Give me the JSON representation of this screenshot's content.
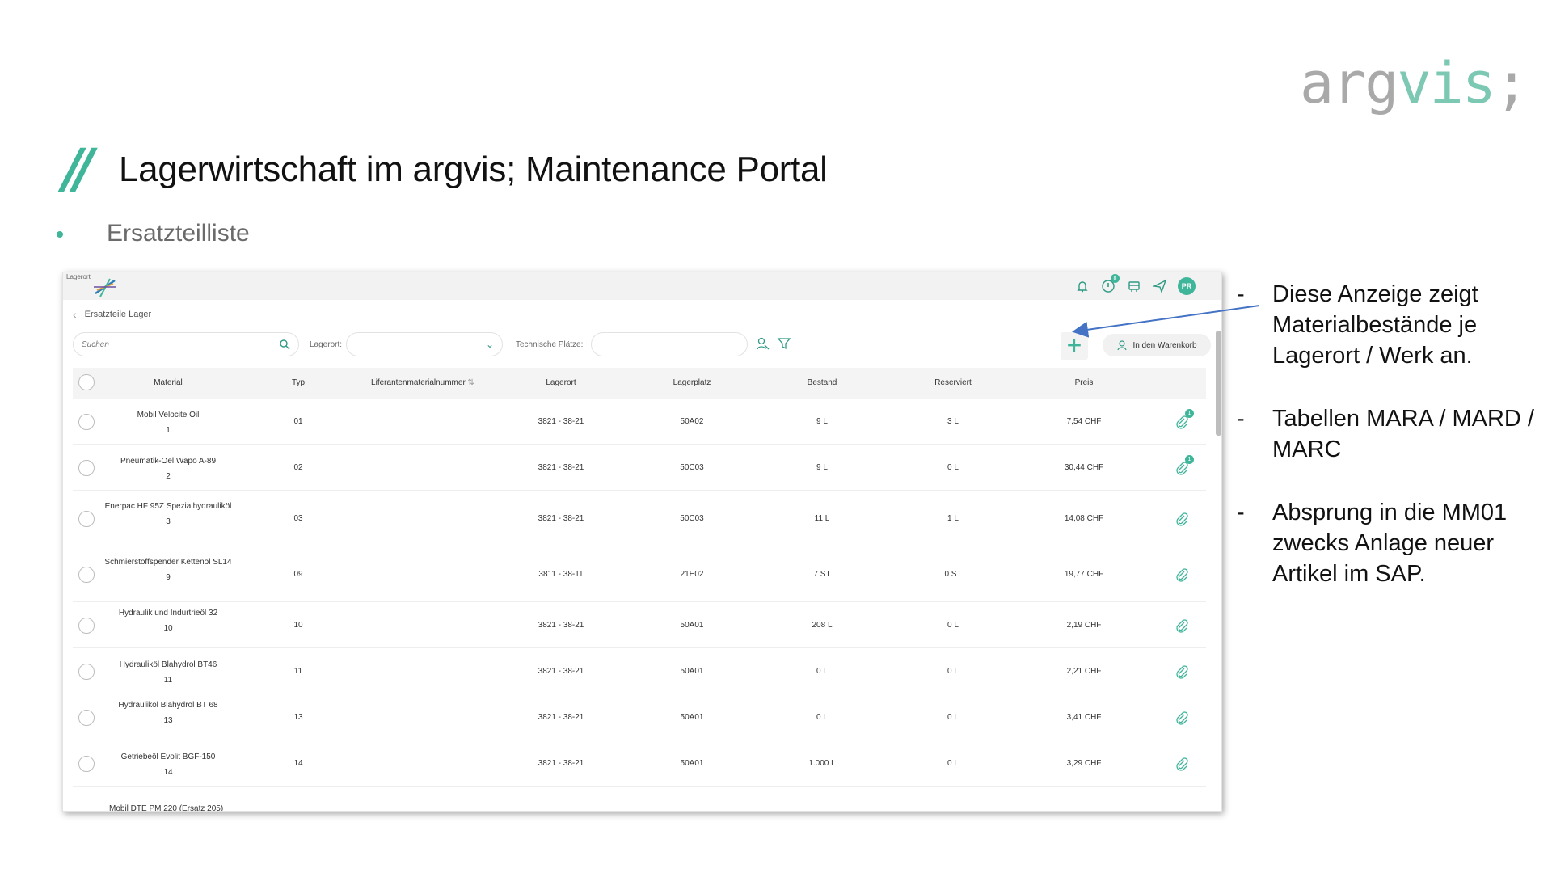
{
  "slide": {
    "logo_part1": "arg",
    "logo_part2": "vis",
    "logo_part3": ";",
    "slashes": "//",
    "title": "Lagerwirtschaft im argvis; Maintenance Portal",
    "subtitle": "Ersatzteilliste"
  },
  "app": {
    "topbar_tag": "Lagerort",
    "notification_badge": "8",
    "avatar_initials": "PR",
    "breadcrumb": "Ersatzteile Lager",
    "search_placeholder": "Suchen",
    "lagerort_label": "Lagerort:",
    "plaetze_label": "Technische Plätze:",
    "cart_label": "In den Warenkorb",
    "columns": {
      "material": "Material",
      "typ": "Typ",
      "lieferant": "Liferantenmaterialnummer",
      "sort": "⇅",
      "lagerort": "Lagerort",
      "lagerplatz": "Lagerplatz",
      "bestand": "Bestand",
      "reserviert": "Reserviert",
      "preis": "Preis"
    },
    "rows": [
      {
        "name": "Mobil Velocite Oil",
        "num": "1",
        "typ": "01",
        "lagerort": "3821 - 38-21",
        "lagerplatz": "50A02",
        "bestand": "9 L",
        "reserviert": "3 L",
        "preis": "7,54 CHF",
        "attachments": "1"
      },
      {
        "name": "Pneumatik-Oel Wapo A-89",
        "num": "2",
        "typ": "02",
        "lagerort": "3821 - 38-21",
        "lagerplatz": "50C03",
        "bestand": "9 L",
        "reserviert": "0 L",
        "preis": "30,44 CHF",
        "attachments": "1"
      },
      {
        "name": "Enerpac HF 95Z Spezialhydrauliköl",
        "num": "3",
        "typ": "03",
        "lagerort": "3821 - 38-21",
        "lagerplatz": "50C03",
        "bestand": "11 L",
        "reserviert": "1 L",
        "preis": "14,08 CHF",
        "attachments": ""
      },
      {
        "name": "Schmierstoffspender Kettenöl SL14",
        "num": "9",
        "typ": "09",
        "lagerort": "3811 - 38-11",
        "lagerplatz": "21E02",
        "bestand": "7 ST",
        "reserviert": "0 ST",
        "preis": "19,77 CHF",
        "attachments": ""
      },
      {
        "name": "Hydraulik und Indurtrieöl 32",
        "num": "10",
        "typ": "10",
        "lagerort": "3821 - 38-21",
        "lagerplatz": "50A01",
        "bestand": "208 L",
        "reserviert": "0 L",
        "preis": "2,19 CHF",
        "attachments": ""
      },
      {
        "name": "Hydrauliköl Blahydrol BT46",
        "num": "11",
        "typ": "11",
        "lagerort": "3821 - 38-21",
        "lagerplatz": "50A01",
        "bestand": "0 L",
        "reserviert": "0 L",
        "preis": "2,21 CHF",
        "attachments": ""
      },
      {
        "name": "Hydrauliköl Blahydrol BT 68",
        "num": "13",
        "typ": "13",
        "lagerort": "3821 - 38-21",
        "lagerplatz": "50A01",
        "bestand": "0 L",
        "reserviert": "0 L",
        "preis": "3,41 CHF",
        "attachments": ""
      },
      {
        "name": "Getriebeöl Evolit BGF-150",
        "num": "14",
        "typ": "14",
        "lagerort": "3821 - 38-21",
        "lagerplatz": "50A01",
        "bestand": "1.000 L",
        "reserviert": "0 L",
        "preis": "3,29 CHF",
        "attachments": ""
      }
    ],
    "peek_row": "Mobil DTE PM 220 (Ersatz 205)"
  },
  "notes": [
    {
      "dash": "-",
      "text": "Diese Anzeige zeigt Materialbestände je Lagerort / Werk an."
    },
    {
      "dash": "-",
      "text": "Tabellen MARA / MARD / MARC"
    },
    {
      "dash": "-",
      "text": "Absprung in die MM01 zwecks Anlage neuer Artikel im SAP."
    }
  ],
  "colors": {
    "accent": "#3fb59a",
    "arrow": "#4472c4",
    "logo_gray": "#a9a9a9",
    "logo_green": "#7cc8b2"
  }
}
